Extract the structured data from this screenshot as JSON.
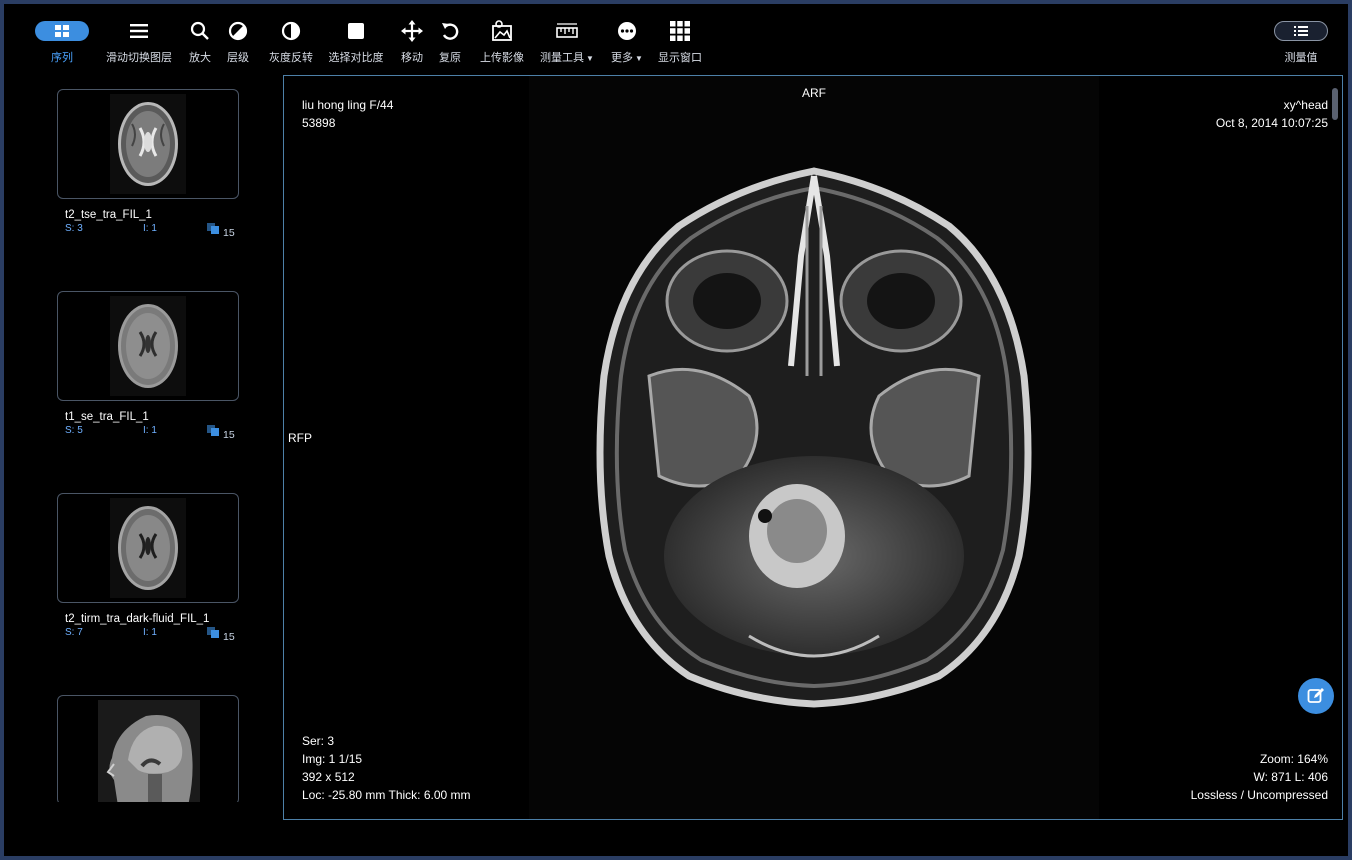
{
  "toolbar": {
    "items": [
      {
        "label": "序列",
        "icon": "grid-icon"
      },
      {
        "label": "滑动切换图层",
        "icon": "menu-icon"
      },
      {
        "label": "放大",
        "icon": "search-icon"
      },
      {
        "label": "层级",
        "icon": "contrast-icon"
      },
      {
        "label": "灰度反转",
        "icon": "invert-icon"
      },
      {
        "label": "选择对比度",
        "icon": "square-icon"
      },
      {
        "label": "移动",
        "icon": "move-icon"
      },
      {
        "label": "复原",
        "icon": "undo-icon"
      },
      {
        "label": "上传影像",
        "icon": "upload-image-icon"
      },
      {
        "label": "测量工具",
        "icon": "ruler-icon"
      },
      {
        "label": "更多",
        "icon": "more-icon"
      },
      {
        "label": "显示窗口",
        "icon": "layout-icon"
      }
    ],
    "measure_label": "测量值"
  },
  "series": [
    {
      "name": "t2_tse_tra_FIL_1",
      "s": "S: 3",
      "i": "I: 1",
      "count": "15"
    },
    {
      "name": "t1_se_tra_FIL_1",
      "s": "S: 5",
      "i": "I: 1",
      "count": "15"
    },
    {
      "name": "t2_tirm_tra_dark-fluid_FIL_1",
      "s": "S: 7",
      "i": "I: 1",
      "count": "15"
    },
    {
      "name": "",
      "s": "",
      "i": "",
      "count": ""
    }
  ],
  "viewer": {
    "patient_name": "liu hong ling F/44",
    "patient_id": "53898",
    "orientation_top": "ARF",
    "orientation_left": "RFP",
    "study_desc": "xy^head",
    "study_date": "Oct 8, 2014 10:07:25",
    "ser": "Ser: 3",
    "img": "Img: 1 1/15",
    "dims": "392 x 512",
    "loc": "Loc: -25.80 mm Thick: 6.00 mm",
    "zoom": "Zoom: 164%",
    "wl": "W: 871 L: 406",
    "compression": "Lossless / Uncompressed"
  },
  "colors": {
    "accent": "#3c8ee0",
    "label_blue": "#6fb0ff",
    "viewport_border": "#4d80a8",
    "frame": "#2a3d63"
  }
}
